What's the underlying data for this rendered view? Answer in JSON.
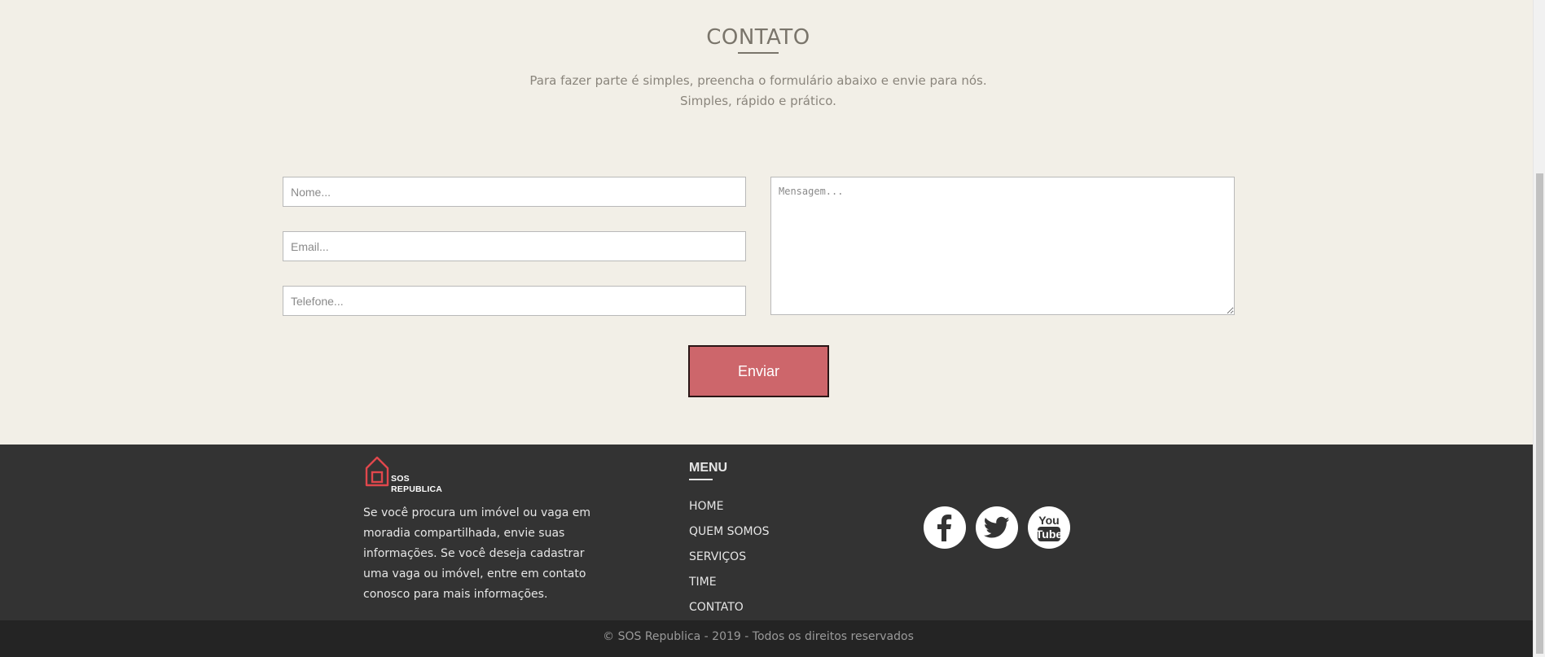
{
  "contact": {
    "title": "CONTATO",
    "subtitle_line1": "Para fazer parte é simples, preencha o formulário abaixo e envie para nós.",
    "subtitle_line2": "Simples, rápido e prático.",
    "form": {
      "name_placeholder": "Nome...",
      "name_value": "",
      "email_placeholder": "Email...",
      "email_value": "",
      "phone_placeholder": "Telefone...",
      "phone_value": "",
      "message_placeholder": "Mensagem...",
      "message_value": "",
      "submit_label": "Enviar"
    }
  },
  "footer": {
    "logo_line1": "SOS",
    "logo_line2": "REPUBLICA",
    "description": "Se você procura um imóvel ou vaga em moradia compartilhada, envie suas informações. Se você deseja cadastrar uma vaga ou imóvel, entre em contato conosco para mais informações.",
    "menu_title": "MENU",
    "menu_items": [
      "HOME",
      "QUEM SOMOS",
      "SERVIÇOS",
      "TIME",
      "CONTATO"
    ],
    "social_icons": [
      "facebook-icon",
      "twitter-icon",
      "youtube-icon"
    ],
    "copyright": "© SOS Republica - 2019 - Todos os direitos reservados"
  },
  "colors": {
    "background": "#f2efe7",
    "accent_button": "#cd666b",
    "footer_bg": "#333333",
    "copyright_bg": "#242424",
    "logo_red": "#e0474c"
  }
}
